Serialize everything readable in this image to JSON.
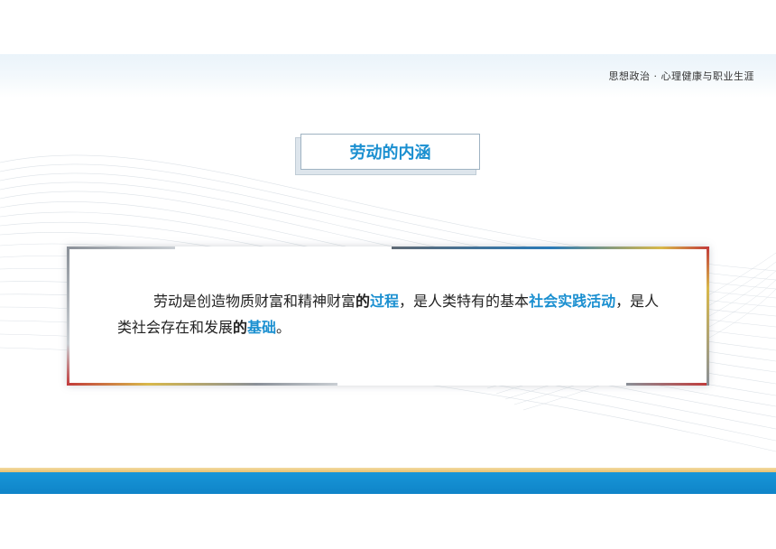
{
  "header": {
    "subject_title": "思想政治 · 心理健康与职业生涯"
  },
  "section": {
    "title": "劳动的内涵"
  },
  "definition": {
    "s1": "劳动是创造物质财富和精神财富",
    "s2": "的",
    "s3": "过程",
    "s4": "，是人类特有的基本",
    "s5": "社会实践活动",
    "s6": "，是人类社会存在和发展",
    "s7": "的",
    "s8": "基础",
    "s9": "。"
  },
  "colors": {
    "accent": "#1a8fd0",
    "band_blue": "#1896d8",
    "band_gold": "#e8c070"
  }
}
